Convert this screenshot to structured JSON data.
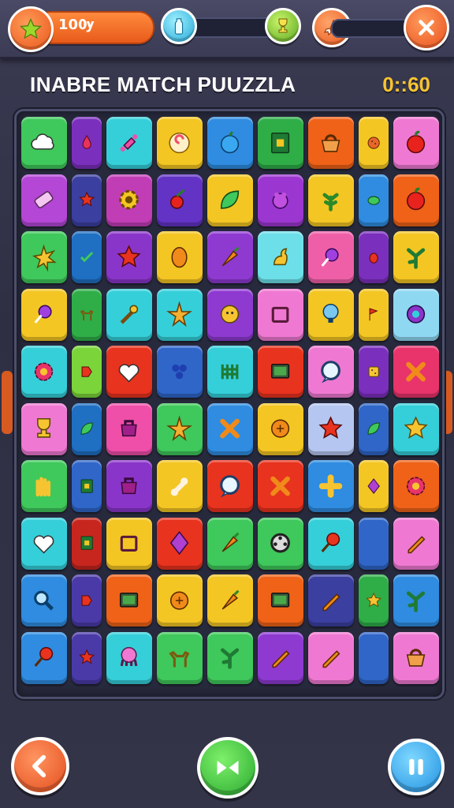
{
  "hud": {
    "score": "10Ѹ",
    "level_progress": 0.12,
    "icons": [
      "star-icon",
      "bottle-icon",
      "trophy-icon",
      "rocket-icon",
      "close-icon"
    ]
  },
  "header": {
    "title": "INABRE MATCH PUUZZLA",
    "timer": "0::60"
  },
  "board": {
    "rows": [
      [
        {
          "w": "big",
          "color": "#3fc85b",
          "icon": "cloud"
        },
        {
          "w": "small",
          "color": "#7b2fbd",
          "icon": "drop"
        },
        {
          "w": "big",
          "color": "#35cfd9",
          "icon": "candy"
        },
        {
          "w": "big",
          "color": "#f4c623",
          "icon": "swirl"
        },
        {
          "w": "big",
          "color": "#2f8ce0",
          "icon": "berry"
        },
        {
          "w": "big",
          "color": "#2fae48",
          "icon": "book"
        },
        {
          "w": "big",
          "color": "#ef6218",
          "icon": "basket"
        },
        {
          "w": "small",
          "color": "#f4c623",
          "icon": "cookie"
        },
        {
          "w": "big",
          "color": "#ef79d2",
          "icon": "apple"
        }
      ],
      [
        {
          "w": "big",
          "color": "#b447d6",
          "icon": "eraser"
        },
        {
          "w": "small",
          "color": "#3b3fa0",
          "icon": "star"
        },
        {
          "w": "big",
          "color": "#c13db6",
          "icon": "gear"
        },
        {
          "w": "big",
          "color": "#6233c4",
          "icon": "cherry"
        },
        {
          "w": "big",
          "color": "#f4c623",
          "icon": "leaf"
        },
        {
          "w": "big",
          "color": "#9b37d0",
          "icon": "frog"
        },
        {
          "w": "big",
          "color": "#f4c623",
          "icon": "plant"
        },
        {
          "w": "small",
          "color": "#2f8ce0",
          "icon": "turtle"
        },
        {
          "w": "big",
          "color": "#ef6218",
          "icon": "apple"
        }
      ],
      [
        {
          "w": "big",
          "color": "#3fc85b",
          "icon": "burst"
        },
        {
          "w": "small",
          "color": "#1f6fc2",
          "icon": "check"
        },
        {
          "w": "big",
          "color": "#8a35c9",
          "icon": "star"
        },
        {
          "w": "big",
          "color": "#f4c623",
          "icon": "lemon"
        },
        {
          "w": "big",
          "color": "#8e3ad1",
          "icon": "carrot"
        },
        {
          "w": "big",
          "color": "#6cdfe8",
          "icon": "duck"
        },
        {
          "w": "big",
          "color": "#ef5fa8",
          "icon": "lolly"
        },
        {
          "w": "small",
          "color": "#7b2fbd",
          "icon": "bug"
        },
        {
          "w": "big",
          "color": "#f4c623",
          "icon": "sprout"
        }
      ],
      [
        {
          "w": "big",
          "color": "#f4c623",
          "icon": "lolly"
        },
        {
          "w": "small",
          "color": "#2fae48",
          "icon": "deer"
        },
        {
          "w": "big",
          "color": "#35cfd9",
          "icon": "wand"
        },
        {
          "w": "big",
          "color": "#35cfd9",
          "icon": "starfish"
        },
        {
          "w": "big",
          "color": "#8e3ad1",
          "icon": "face"
        },
        {
          "w": "big",
          "color": "#ef79d2",
          "icon": "box"
        },
        {
          "w": "big",
          "color": "#f4c623",
          "icon": "bulb"
        },
        {
          "w": "small",
          "color": "#f4c623",
          "icon": "flag"
        },
        {
          "w": "big",
          "color": "#8fd8f2",
          "icon": "orb"
        }
      ],
      [
        {
          "w": "big",
          "color": "#35cfd9",
          "icon": "flower"
        },
        {
          "w": "small",
          "color": "#7bd43a",
          "icon": "tag"
        },
        {
          "w": "big",
          "color": "#e8331e",
          "icon": "heart"
        },
        {
          "w": "big",
          "color": "#2f66c8",
          "icon": "dots"
        },
        {
          "w": "big",
          "color": "#35cfd9",
          "icon": "fence"
        },
        {
          "w": "big",
          "color": "#e8331e",
          "icon": "tv"
        },
        {
          "w": "big",
          "color": "#ef79d2",
          "icon": "bubble"
        },
        {
          "w": "small",
          "color": "#7b2fbd",
          "icon": "dice"
        },
        {
          "w": "big",
          "color": "#e8336b",
          "icon": "cross"
        }
      ],
      [
        {
          "w": "big",
          "color": "#ef79d2",
          "icon": "cup"
        },
        {
          "w": "small",
          "color": "#1f6fc2",
          "icon": "leaf"
        },
        {
          "w": "big",
          "color": "#ef4fa8",
          "icon": "pot"
        },
        {
          "w": "big",
          "color": "#3fc85b",
          "icon": "starfish"
        },
        {
          "w": "big",
          "color": "#2f8ce0",
          "icon": "cross"
        },
        {
          "w": "big",
          "color": "#f4c623",
          "icon": "orange"
        },
        {
          "w": "big",
          "color": "#b5c6f0",
          "icon": "star"
        },
        {
          "w": "small",
          "color": "#2f66c8",
          "icon": "leaf"
        },
        {
          "w": "big",
          "color": "#35cfd9",
          "icon": "starGold"
        }
      ],
      [
        {
          "w": "big",
          "color": "#3fc85b",
          "icon": "fries"
        },
        {
          "w": "small",
          "color": "#2f66c8",
          "icon": "book"
        },
        {
          "w": "big",
          "color": "#8a35c9",
          "icon": "pot"
        },
        {
          "w": "big",
          "color": "#f4c623",
          "icon": "bone"
        },
        {
          "w": "big",
          "color": "#e8331e",
          "icon": "bubble"
        },
        {
          "w": "big",
          "color": "#e8331e",
          "icon": "cross"
        },
        {
          "w": "big",
          "color": "#2f8ce0",
          "icon": "plus"
        },
        {
          "w": "small",
          "color": "#f4c623",
          "icon": "gem"
        },
        {
          "w": "big",
          "color": "#ef6218",
          "icon": "flower"
        }
      ],
      [
        {
          "w": "big",
          "color": "#35cfd9",
          "icon": "heart"
        },
        {
          "w": "small",
          "color": "#c7261e",
          "icon": "book"
        },
        {
          "w": "big",
          "color": "#f4c623",
          "icon": "box"
        },
        {
          "w": "big",
          "color": "#e8331e",
          "icon": "gem"
        },
        {
          "w": "big",
          "color": "#3fc85b",
          "icon": "carrot"
        },
        {
          "w": "big",
          "color": "#3fc85b",
          "icon": "film"
        },
        {
          "w": "big",
          "color": "#35cfd9",
          "icon": "racket"
        },
        {
          "w": "small",
          "color": "#2f66c8",
          "icon": "none"
        },
        {
          "w": "big",
          "color": "#ef79d2",
          "icon": "pencil"
        }
      ],
      [
        {
          "w": "big",
          "color": "#2f8ce0",
          "icon": "magnifier"
        },
        {
          "w": "small",
          "color": "#4a3aa8",
          "icon": "tag"
        },
        {
          "w": "big",
          "color": "#ef6218",
          "icon": "tv"
        },
        {
          "w": "big",
          "color": "#f4c623",
          "icon": "orange"
        },
        {
          "w": "big",
          "color": "#f4c623",
          "icon": "carrot"
        },
        {
          "w": "big",
          "color": "#ef6218",
          "icon": "tv"
        },
        {
          "w": "big",
          "color": "#3b3fa0",
          "icon": "pencil"
        },
        {
          "w": "small",
          "color": "#2fae48",
          "icon": "starGold"
        },
        {
          "w": "big",
          "color": "#2f8ce0",
          "icon": "sprout"
        }
      ],
      [
        {
          "w": "big",
          "color": "#2f8ce0",
          "icon": "racket"
        },
        {
          "w": "small",
          "color": "#4a3aa8",
          "icon": "star"
        },
        {
          "w": "big",
          "color": "#35cfd9",
          "icon": "octopus"
        },
        {
          "w": "big",
          "color": "#3fc85b",
          "icon": "deer"
        },
        {
          "w": "big",
          "color": "#3fc85b",
          "icon": "sprout"
        },
        {
          "w": "big",
          "color": "#8e3ad1",
          "icon": "pencil"
        },
        {
          "w": "big",
          "color": "#ef79d2",
          "icon": "pencil"
        },
        {
          "w": "small",
          "color": "#2f66c8",
          "icon": "none"
        },
        {
          "w": "big",
          "color": "#ef79d2",
          "icon": "basket"
        }
      ]
    ]
  },
  "controls": {
    "icons": [
      "back-arrow-icon",
      "play-icon",
      "pause-icon"
    ]
  }
}
